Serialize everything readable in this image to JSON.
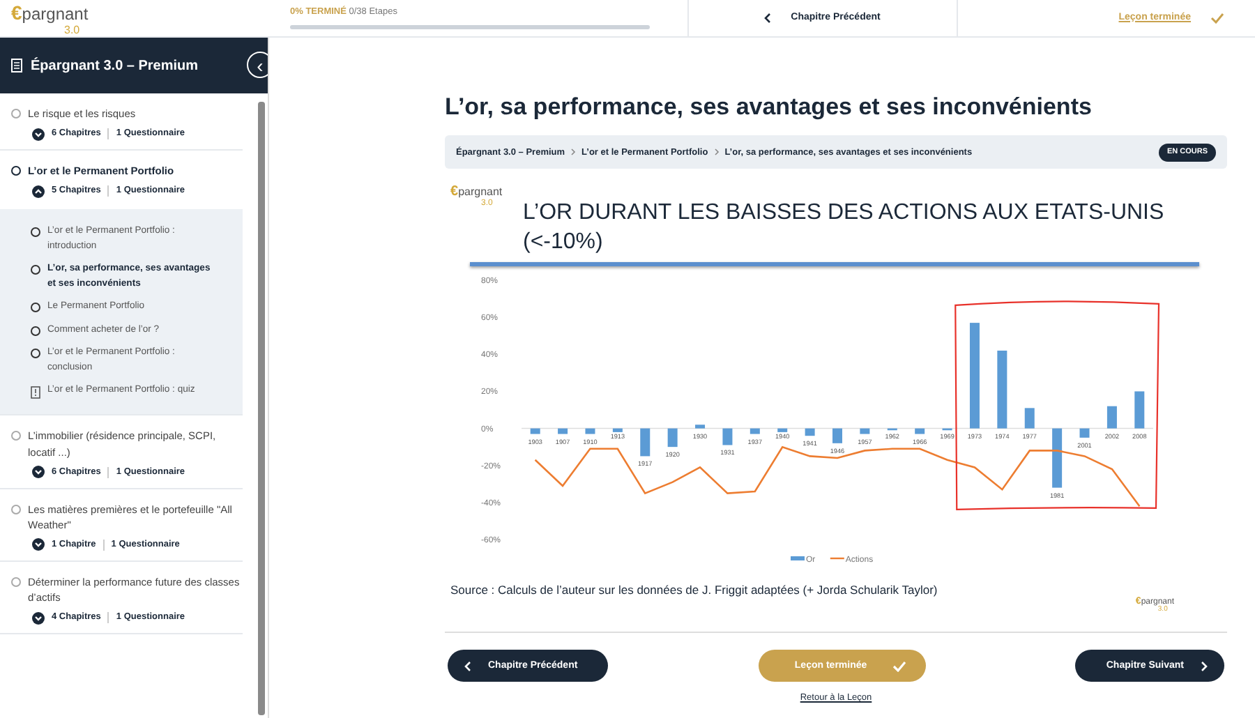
{
  "logo": {
    "mark": "€",
    "word": "pargnant",
    "version": "3.0"
  },
  "progress": {
    "label": "0% TERMINÉ",
    "steps": "0/38 Etapes"
  },
  "top_nav": {
    "previous": "Chapitre Précédent",
    "complete": "Leçon terminée"
  },
  "sidebar": {
    "title": "Épargnant 3.0 – Premium",
    "collapse_icon": "‹",
    "sections": [
      {
        "title": "Le risque et les risques",
        "expanded": false,
        "chapters": "6 Chapitres",
        "quizzes": "1 Questionnaire"
      },
      {
        "title": "L’or et le Permanent Portfolio",
        "expanded": true,
        "chapters": "5 Chapitres",
        "quizzes": "1 Questionnaire",
        "children": [
          {
            "kind": "lesson",
            "title": "L’or et le Permanent Portfolio : introduction",
            "selected": false
          },
          {
            "kind": "lesson",
            "title": "L’or, sa performance, ses avantages et ses inconvénients",
            "selected": true
          },
          {
            "kind": "lesson",
            "title": "Le Permanent Portfolio",
            "selected": false
          },
          {
            "kind": "lesson",
            "title": "Comment acheter de l’or ?",
            "selected": false
          },
          {
            "kind": "lesson",
            "title": "L’or et le Permanent Portfolio : conclusion",
            "selected": false
          },
          {
            "kind": "quiz",
            "title": "L’or et le Permanent Portfolio : quiz",
            "selected": false
          }
        ]
      },
      {
        "title": "L’immobilier (résidence principale, SCPI, locatif ...)",
        "expanded": false,
        "chapters": "6 Chapitres",
        "quizzes": "1 Questionnaire"
      },
      {
        "title": "Les matières premières et le portefeuille \"All Weather\"",
        "expanded": false,
        "chapters": "1 Chapitre",
        "quizzes": "1 Questionnaire"
      },
      {
        "title": "Déterminer la performance future des classes d’actifs",
        "expanded": false,
        "chapters": "4 Chapitres",
        "quizzes": "1 Questionnaire"
      }
    ]
  },
  "main": {
    "title": "L’or, sa performance, ses avantages et ses inconvénients",
    "breadcrumb": [
      "Épargnant 3.0 – Premium",
      "L’or et le Permanent Portfolio",
      "L’or, sa performance, ses avantages et ses inconvénients"
    ],
    "status": "EN COURS",
    "slide": {
      "logo": {
        "mark": "€",
        "word": "pargnant",
        "version": "3.0"
      },
      "title": "L’OR DURANT LES BAISSES DES ACTIONS AUX ETATS-UNIS (<-10%)",
      "chart_data": {
        "type": "bar",
        "categories": [
          "1903",
          "1907",
          "1910",
          "1913",
          "1917",
          "1920",
          "1930",
          "1931",
          "1937",
          "1940",
          "1941",
          "1946",
          "1957",
          "1962",
          "1966",
          "1969",
          "1973",
          "1974",
          "1977",
          "1981",
          "2001",
          "2002",
          "2008"
        ],
        "series": [
          {
            "name": "Or",
            "type": "bar",
            "color": "#5b9bd5",
            "values": [
              -3,
              -3,
              -3,
              -2,
              -15,
              -10,
              2,
              -9,
              -3,
              -2,
              -4,
              -8,
              -3,
              -1,
              -3,
              -1,
              57,
              42,
              11,
              -32,
              -5,
              12,
              20
            ]
          },
          {
            "name": "Actions",
            "type": "line",
            "color": "#ed7d31",
            "values": [
              -17,
              -31,
              -11,
              -11,
              -35,
              -29,
              -21,
              -35,
              -34,
              -10,
              -15,
              -16,
              -12,
              -11,
              -11,
              -17,
              -21,
              -33,
              -12,
              -12,
              -15,
              -22,
              -42
            ]
          }
        ],
        "legend": "bottom",
        "ylim": [
          -60,
          80
        ],
        "yticks": [
          {
            "value": 80,
            "label": "80%"
          },
          {
            "value": 60,
            "label": "60%"
          },
          {
            "value": 40,
            "label": "40%"
          },
          {
            "value": 20,
            "label": "20%"
          },
          {
            "value": 0,
            "label": "0%"
          },
          {
            "value": -20,
            "label": "-20%"
          },
          {
            "value": -40,
            "label": "-40%"
          },
          {
            "value": -60,
            "label": "-60%"
          }
        ]
      },
      "source": "Source : Calculs de l’auteur sur les données de J. Friggit adaptées (+ Jorda Schularik Taylor)",
      "footer_logo": {
        "mark": "€",
        "word": "pargnant",
        "version": "3.0"
      }
    },
    "buttons": {
      "previous": "Chapitre Précédent",
      "complete": "Leçon terminée",
      "next": "Chapitre Suivant"
    },
    "back_link": "Retour à la Leçon"
  }
}
